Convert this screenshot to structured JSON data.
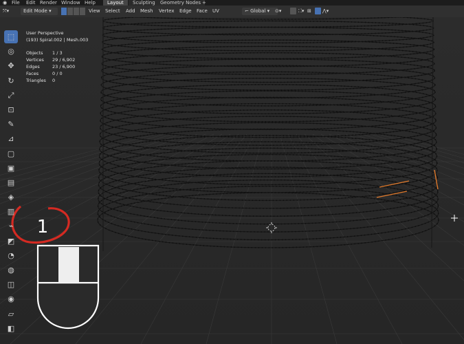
{
  "topbar": {
    "menus": [
      "File",
      "Edit",
      "Render",
      "Window",
      "Help"
    ],
    "workspaces": [
      "Layout",
      "Sculpting",
      "Geometry Nodes"
    ],
    "active_workspace": "Layout",
    "add_tab": "+"
  },
  "header": {
    "mode": "Edit Mode",
    "menus": [
      "View",
      "Select",
      "Add",
      "Mesh",
      "Vertex",
      "Edge",
      "Face",
      "UV"
    ],
    "transform_orientation": "Global"
  },
  "overlay": {
    "perspective": "User Perspective",
    "object_line": "(193) Spiral.002 | Mesh.003",
    "stats": [
      {
        "label": "Objects",
        "value": "1 / 3"
      },
      {
        "label": "Vertices",
        "value": "29 / 6,902"
      },
      {
        "label": "Edges",
        "value": "23 / 6,900"
      },
      {
        "label": "Faces",
        "value": "0 / 0"
      },
      {
        "label": "Triangles",
        "value": "0"
      }
    ]
  },
  "annotation": {
    "step_number": "1",
    "circle_color": "#d42a22",
    "mouse_button_pressed": "left"
  },
  "toolbar": {
    "tools": [
      "select-box-icon",
      "cursor-icon",
      "move-icon",
      "rotate-icon",
      "scale-icon",
      "transform-icon",
      "annotate-icon",
      "measure-icon",
      "add-cube-icon",
      "extrude-icon",
      "inset-icon",
      "bevel-icon",
      "loop-cut-icon",
      "knife-icon",
      "poly-build-icon",
      "spin-icon",
      "smooth-icon",
      "edge-slide-icon",
      "shrink-fatten-icon",
      "shear-icon",
      "rip-icon"
    ]
  },
  "colors": {
    "accent": "#4772b3",
    "selected_edge": "#e07a2c",
    "background": "#2a2a2a"
  }
}
